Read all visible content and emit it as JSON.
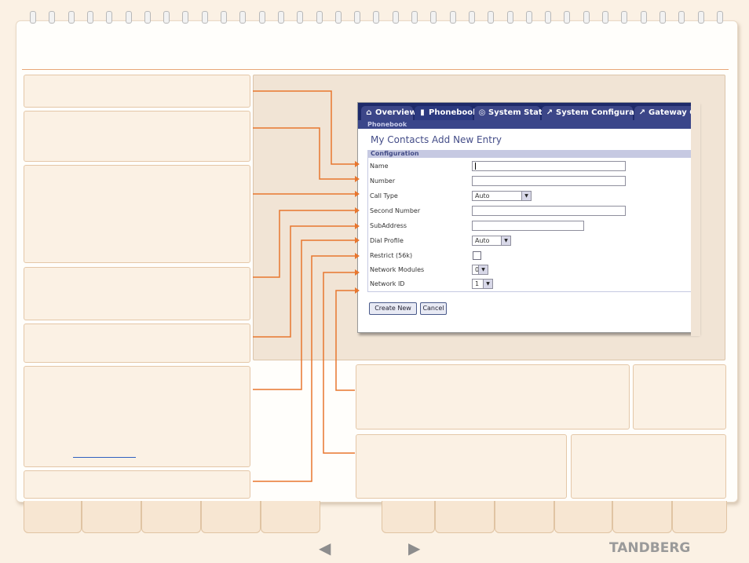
{
  "tabs": [
    {
      "icon": "home-icon",
      "glyph": "⌂",
      "label": "Overview"
    },
    {
      "icon": "book-icon",
      "glyph": "▮",
      "label": "Phonebook"
    },
    {
      "icon": "status-icon",
      "glyph": "◎",
      "label": "System Status"
    },
    {
      "icon": "wrench-icon",
      "glyph": "↗",
      "label": "System Configuration"
    },
    {
      "icon": "wrench-icon",
      "glyph": "↗",
      "label": "Gateway Con"
    }
  ],
  "breadcrumb": "Phonebook",
  "page_title": "My Contacts Add New Entry",
  "section_title": "Configuration",
  "fields": {
    "name": "Name",
    "number": "Number",
    "call_type": "Call Type",
    "second_number": "Second Number",
    "subaddress": "SubAddress",
    "dial_profile": "Dial Profile",
    "restrict": "Restrict (56k)",
    "network_modules": "Network Modules",
    "network_id": "Network ID"
  },
  "values": {
    "call_type": "Auto",
    "dial_profile": "Auto",
    "network_modules": "0",
    "network_id": "1"
  },
  "buttons": {
    "create": "Create New",
    "cancel": "Cancel"
  },
  "brand": "TANDBERG",
  "nav": {
    "prev": "◀",
    "next": "▶"
  },
  "colors": {
    "accent": "#e8762e",
    "tabbar": "#1e2a6a"
  }
}
